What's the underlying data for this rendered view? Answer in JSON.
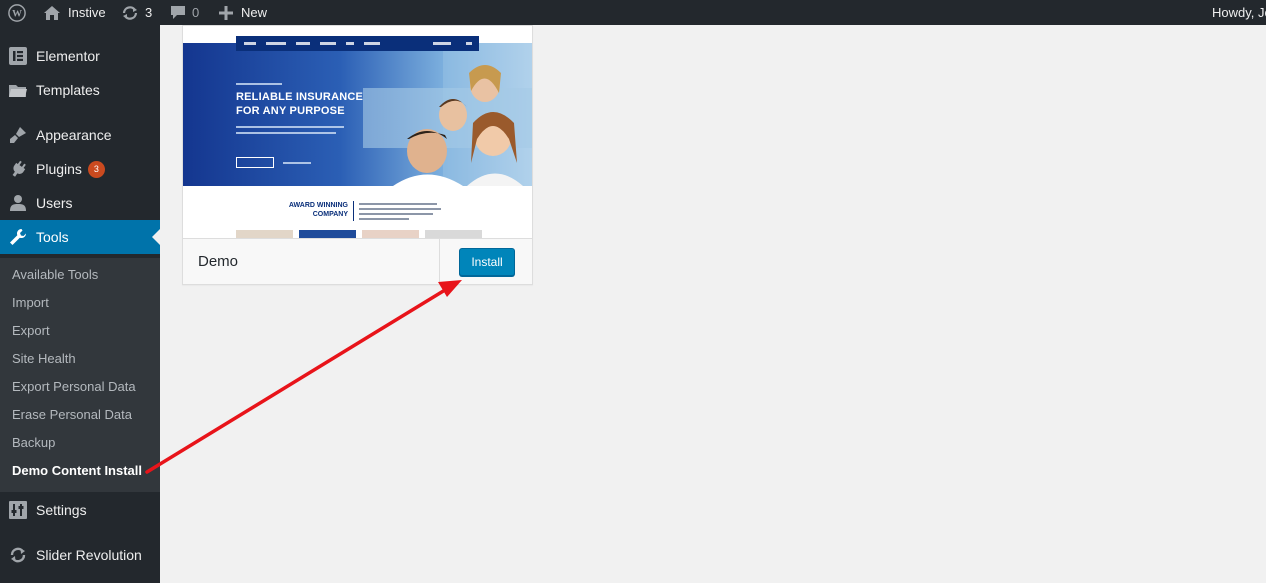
{
  "admin_bar": {
    "site_name": "Instive",
    "updates_count": "3",
    "comments_count": "0",
    "new_label": "New",
    "greeting": "Howdy, Jo"
  },
  "sidebar": {
    "items": [
      {
        "label": "Elementor",
        "icon": "elementor-icon"
      },
      {
        "label": "Templates",
        "icon": "folder-icon"
      },
      {
        "label": "Appearance",
        "icon": "brush-icon"
      },
      {
        "label": "Plugins",
        "icon": "plugin-icon",
        "badge": "3"
      },
      {
        "label": "Users",
        "icon": "user-icon"
      },
      {
        "label": "Tools",
        "icon": "wrench-icon",
        "current": true
      },
      {
        "label": "Settings",
        "icon": "settings-icon"
      },
      {
        "label": "Slider Revolution",
        "icon": "refresh-icon"
      }
    ],
    "tools_submenu": [
      "Available Tools",
      "Import",
      "Export",
      "Site Health",
      "Export Personal Data",
      "Erase Personal Data",
      "Backup",
      "Demo Content Install"
    ],
    "current_submenu": "Demo Content Install"
  },
  "demo_card": {
    "name": "Demo",
    "install_label": "Install",
    "preview": {
      "headline_1": "RELIABLE INSURANCE",
      "headline_2": "FOR ANY PURPOSE",
      "award_1": "AWARD WINNING",
      "award_2": "COMPANY"
    }
  },
  "colors": {
    "admin_bar": "#23282d",
    "sidebar": "#23282d",
    "submenu": "#32373c",
    "accent": "#0073aa",
    "button": "#0085ba",
    "badge": "#ca4a1f",
    "arrow": "#e8141a",
    "background": "#f1f1f1"
  }
}
